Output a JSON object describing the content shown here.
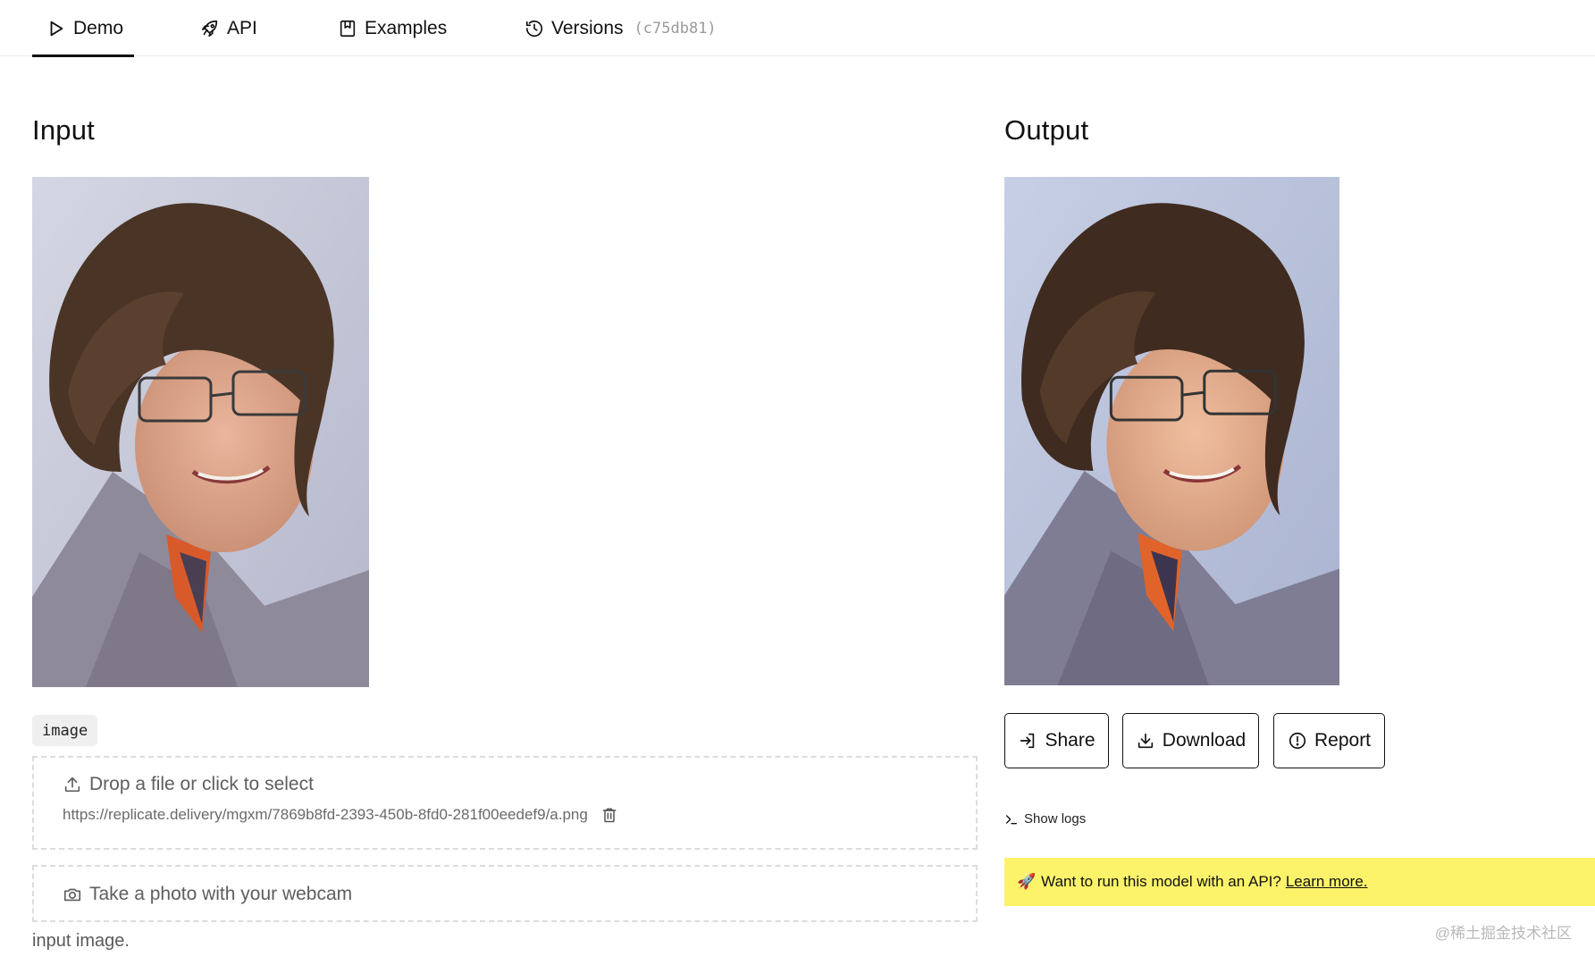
{
  "tabs": [
    {
      "label": "Demo",
      "icon": "play-icon",
      "active": true
    },
    {
      "label": "API",
      "icon": "rocket-icon"
    },
    {
      "label": "Examples",
      "icon": "bookmark-icon"
    },
    {
      "label": "Versions",
      "icon": "history-icon",
      "hash": "(c75db81)"
    }
  ],
  "input": {
    "title": "Input",
    "field_tag": "image",
    "dropzone_label": "Drop a file or click to select",
    "file_url": "https://replicate.delivery/mgxm/7869b8fd-2393-450b-8fd0-281f00eedef9/a.png",
    "webcam_label": "Take a photo with your webcam",
    "hint": "input image."
  },
  "output": {
    "title": "Output",
    "buttons": {
      "share": "Share",
      "download": "Download",
      "report": "Report"
    },
    "show_logs": "Show logs"
  },
  "banner": {
    "emoji": "🚀",
    "text": "Want to run this model with an API?",
    "link": "Learn more."
  },
  "watermark": "@稀土掘金技术社区",
  "colors": {
    "banner": "#fcf36b",
    "accent": "#111111"
  }
}
